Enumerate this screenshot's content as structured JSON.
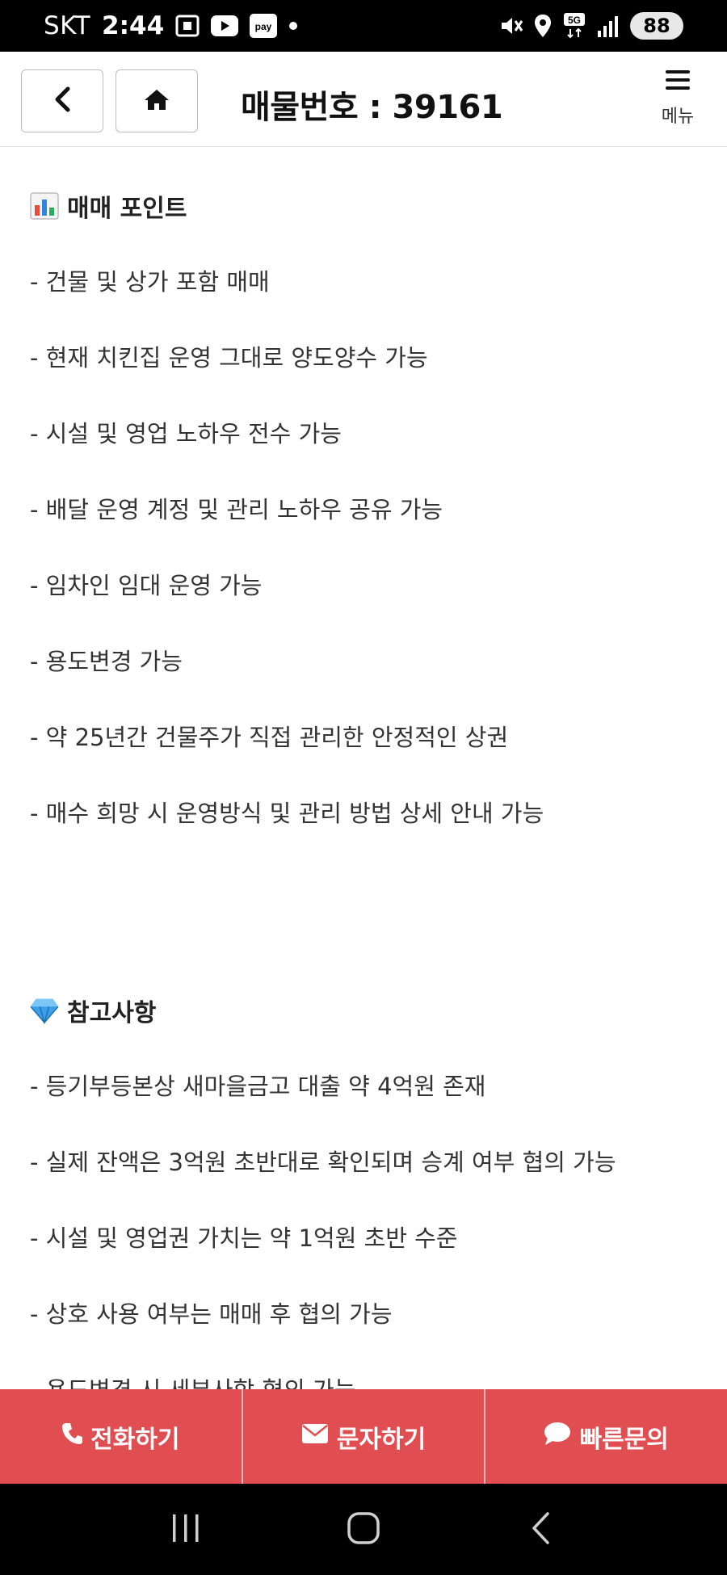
{
  "status_bar": {
    "carrier": "SKT",
    "time": "2:44",
    "battery": "88"
  },
  "header": {
    "title": "매물번호 : 39161",
    "menu_label": "메뉴"
  },
  "sections": [
    {
      "icon": "bar-chart-icon",
      "title": "매매 포인트",
      "items": [
        "- 건물 및 상가 포함 매매",
        "- 현재 치킨집 운영 그대로 양도양수 가능",
        "- 시설 및 영업 노하우 전수 가능",
        "- 배달 운영 계정 및 관리 노하우 공유 가능",
        "- 임차인 임대 운영 가능",
        "- 용도변경 가능",
        "- 약 25년간 건물주가 직접 관리한 안정적인 상권",
        "- 매수 희망 시 운영방식 및 관리 방법 상세 안내 가능"
      ]
    },
    {
      "icon": "gem-icon",
      "title": "참고사항",
      "items": [
        "- 등기부등본상 새마을금고 대출 약 4억원 존재",
        "- 실제 잔액은 3억원 초반대로 확인되며 승계 여부 협의 가능",
        "- 시설 및 영업권 가치는 약 1억원 초반 수준",
        "- 상호 사용 여부는 매매 후 협의 가능",
        "- 용도변경 시 세부사항 협의 가능"
      ]
    }
  ],
  "actions": {
    "call": "전화하기",
    "sms": "문자하기",
    "inquiry": "빠른문의"
  },
  "colors": {
    "accent": "#e04e52"
  }
}
